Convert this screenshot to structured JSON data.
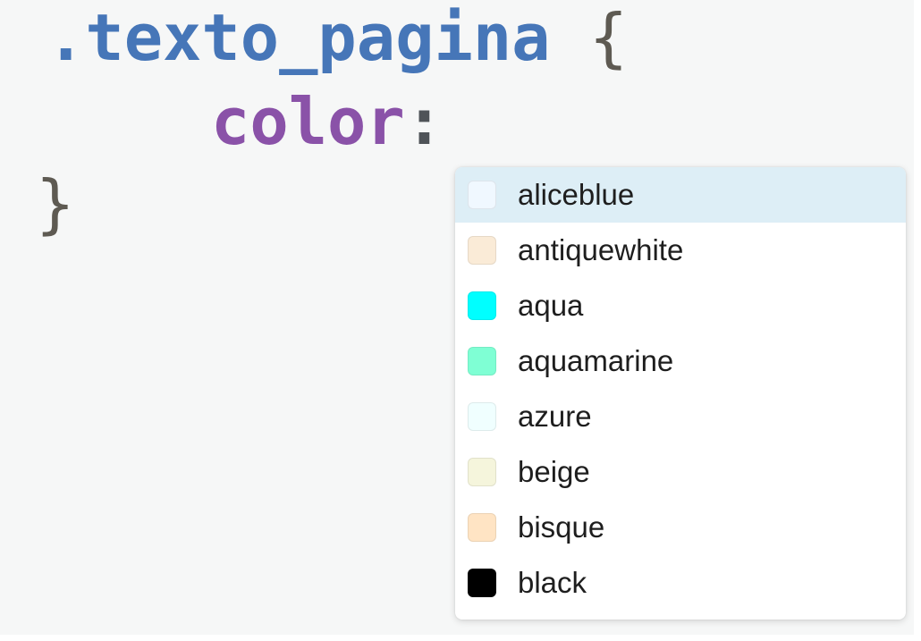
{
  "code": {
    "selector": ".texto_pagina",
    "open_brace": "{",
    "property": "color",
    "colon": ":",
    "close_brace": "}"
  },
  "autocomplete": {
    "selected_index": 0,
    "items": [
      {
        "label": "aliceblue",
        "color": "#f0f8ff"
      },
      {
        "label": "antiquewhite",
        "color": "#faebd7"
      },
      {
        "label": "aqua",
        "color": "#00ffff"
      },
      {
        "label": "aquamarine",
        "color": "#7fffd4"
      },
      {
        "label": "azure",
        "color": "#f0ffff"
      },
      {
        "label": "beige",
        "color": "#f5f5dc"
      },
      {
        "label": "bisque",
        "color": "#ffe4c4"
      },
      {
        "label": "black",
        "color": "#000000"
      }
    ]
  }
}
